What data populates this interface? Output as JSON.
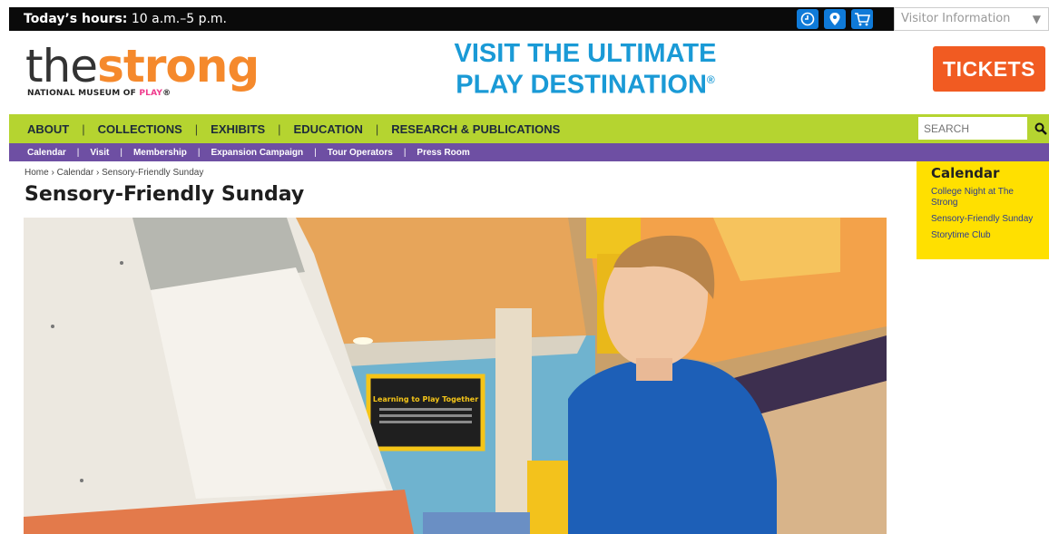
{
  "topbar": {
    "hours_label": "Today’s hours:",
    "hours_value": "10 a.m.–5 p.m.",
    "icons": [
      "clock-icon",
      "map-pin-icon",
      "cart-icon"
    ],
    "visitor_select": "Visitor Information"
  },
  "header": {
    "logo_the": "the",
    "logo_strong": "strong",
    "logo_sub": "NATIONAL MUSEUM OF",
    "logo_sub_play": "PLAY",
    "logo_sub_mark": "®",
    "promo_line1": "VISIT THE ULTIMATE",
    "promo_line2": "PLAY DESTINATION",
    "promo_mark": "®",
    "tickets_label": "TICKETS"
  },
  "mainnav": {
    "items": [
      "ABOUT",
      "COLLECTIONS",
      "EXHIBITS",
      "EDUCATION",
      "RESEARCH & PUBLICATIONS"
    ],
    "search_placeholder": "SEARCH"
  },
  "subnav": {
    "items": [
      "Calendar",
      "Visit",
      "Membership",
      "Expansion Campaign",
      "Tour Operators",
      "Press Room"
    ]
  },
  "breadcrumb": [
    "Home",
    "Calendar",
    "Sensory-Friendly Sunday"
  ],
  "page_title": "Sensory-Friendly Sunday",
  "sidebar": {
    "title": "Calendar",
    "items": [
      "College Night at The Strong",
      "Sensory-Friendly Sunday",
      "Storytime Club"
    ]
  },
  "hero": {
    "sign_title": "Learning to Play Together"
  },
  "colors": {
    "topbar": "#0a0a0a",
    "icon_blue": "#0f7ad8",
    "promo_blue": "#1a9ad6",
    "logo_orange": "#f5892c",
    "tickets_orange": "#f15b22",
    "nav_green": "#b5d430",
    "subnav_purple": "#6e4fa3",
    "calendar_yellow": "#ffe000"
  }
}
